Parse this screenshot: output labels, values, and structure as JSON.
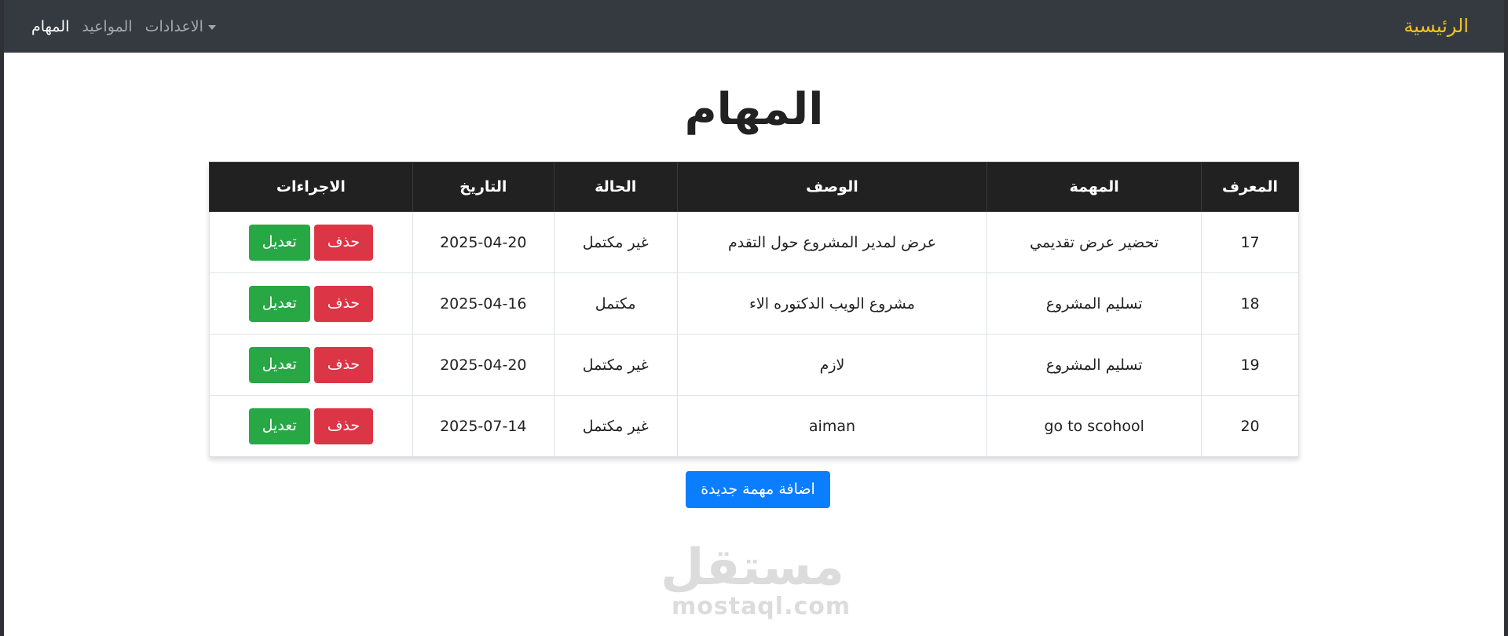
{
  "navbar": {
    "brand": "الرئيسية",
    "links": [
      {
        "label": "المهام",
        "active": true
      },
      {
        "label": "المواعيد",
        "active": false
      },
      {
        "label": "الاعدادات",
        "active": false,
        "dropdown": true
      }
    ]
  },
  "page": {
    "title": "المهام"
  },
  "table": {
    "headers": {
      "id": "المعرف",
      "task": "المهمة",
      "description": "الوصف",
      "status": "الحالة",
      "date": "التاريخ",
      "actions": "الاجراءات"
    },
    "rows": [
      {
        "id": "17",
        "task": "تحضير عرض تقديمي",
        "description": "عرض لمدير المشروع حول التقدم",
        "status": "غير مكتمل",
        "date": "2025-04-20",
        "delete_label": "حذف",
        "edit_label": "تعديل"
      },
      {
        "id": "18",
        "task": "تسليم المشروع",
        "description": "مشروع الويب الدكتوره الاء",
        "status": "مكتمل",
        "date": "2025-04-16",
        "delete_label": "حذف",
        "edit_label": "تعديل"
      },
      {
        "id": "19",
        "task": "تسليم المشروع",
        "description": "لازم",
        "status": "غير مكتمل",
        "date": "2025-04-20",
        "delete_label": "حذف",
        "edit_label": "تعديل"
      },
      {
        "id": "20",
        "task": "go to scohool",
        "description": "aiman",
        "status": "غير مكتمل",
        "date": "2025-07-14",
        "delete_label": "حذف",
        "edit_label": "تعديل"
      }
    ]
  },
  "add_button": {
    "label": "اضافة مهمة جديدة"
  },
  "watermark": {
    "arabic": "مستقل",
    "latin": "mostaql.com"
  },
  "colors": {
    "navbar_bg": "#343a40",
    "brand": "#f5c21b",
    "danger": "#dc3545",
    "success": "#28a745",
    "primary": "#0a7eff",
    "table_header_bg": "#212121"
  }
}
